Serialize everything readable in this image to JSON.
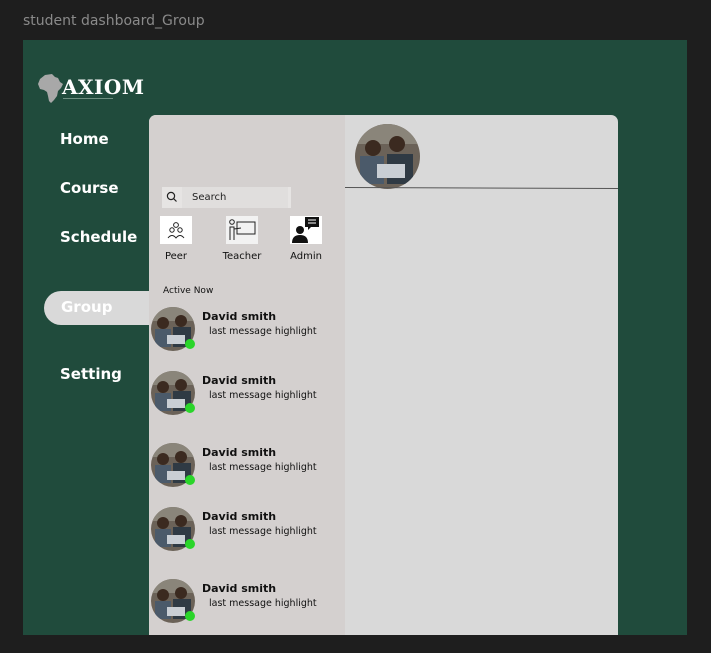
{
  "frame": {
    "title": "student dashboard_Group"
  },
  "brand": {
    "name": "AXIOM"
  },
  "nav": {
    "items": [
      {
        "label": "Home"
      },
      {
        "label": "Course"
      },
      {
        "label": "Schedule"
      },
      {
        "label": "Group",
        "active": true
      },
      {
        "label": "Setting"
      }
    ]
  },
  "search": {
    "placeholder": "Search"
  },
  "categories": [
    {
      "label": "Peer",
      "icon": "peer-group-icon"
    },
    {
      "label": "Teacher",
      "icon": "teacher-icon"
    },
    {
      "label": "Admin",
      "icon": "admin-chat-icon"
    }
  ],
  "active_section": {
    "title": "Active Now"
  },
  "chats": [
    {
      "name": "David smith",
      "message": "last message highlight",
      "online": true
    },
    {
      "name": "David smith",
      "message": "last message highlight",
      "online": true
    },
    {
      "name": "David smith",
      "message": "last message highlight",
      "online": true
    },
    {
      "name": "David smith",
      "message": "last message highlight",
      "online": true
    },
    {
      "name": "David smith",
      "message": "last message highlight",
      "online": true
    }
  ],
  "colors": {
    "background": "#1e1e1e",
    "frame": "#204b3c",
    "panel": "#d9d9d9",
    "list": "#d4d0cf",
    "online": "#2ad52a"
  }
}
